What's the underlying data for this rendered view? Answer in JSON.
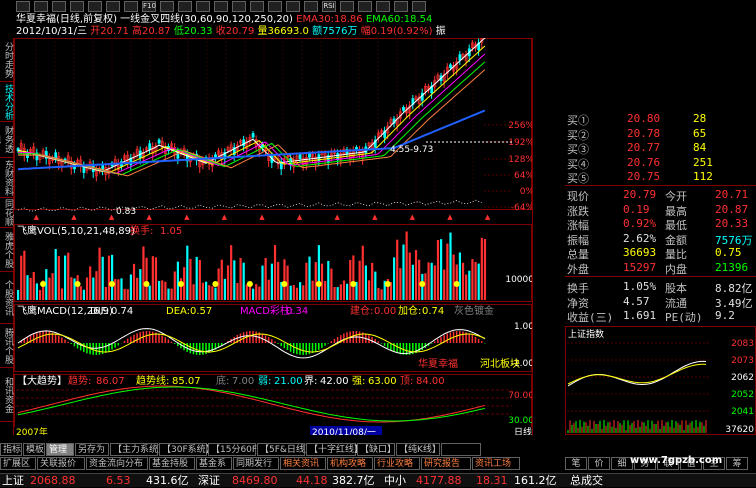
{
  "title_line": {
    "stock": "华夏幸福(日线,前复权)",
    "indicator": "一线金叉四线(30,60,90,120,250,20)",
    "ema30_label": "EMA30:",
    "ema30_value": "18.86",
    "ema60_label": "EMA60:",
    "ema60_value": "18.54"
  },
  "info_line": {
    "date": "2012/10/31/三",
    "open_label": "开",
    "open": "20.71",
    "high_label": "高",
    "high": "20.87",
    "low_label": "低",
    "low": "20.33",
    "close_label": "收",
    "close": "20.79",
    "vol_label": "量",
    "vol": "36693.0",
    "amount_label": "额",
    "amount": "7576万",
    "chg_label": "幅",
    "chg": "0.19(0.92%)",
    "end": "振"
  },
  "toolbar": [
    "",
    "",
    "",
    "",
    "",
    "",
    "",
    "F10",
    "",
    "",
    "",
    "",
    "",
    "",
    "",
    "",
    "",
    "RSI",
    "",
    "",
    "",
    "",
    ""
  ],
  "left_tabs": [
    {
      "label": "分时走势",
      "active": false
    },
    {
      "label": "技术分析",
      "active": true
    },
    {
      "label": "财务透视",
      "active": false
    },
    {
      "label": "东财资料",
      "active": false
    },
    {
      "label": "同花顺",
      "active": false
    },
    {
      "label": "雅虎个股",
      "active": false
    },
    {
      "label": "个股资讯",
      "active": false
    },
    {
      "label": "腾讯个股",
      "active": false
    },
    {
      "label": "和讯资金",
      "active": false
    }
  ],
  "main_chart": {
    "pct_ticks": [
      "256%",
      "192%",
      "128%",
      "64%",
      "0%",
      "-64%"
    ],
    "annotation_high": "4.55-9.73",
    "annotation_low": "0.83"
  },
  "vol_panel": {
    "title": "飞鹰VOL(5,10,21,48,89)",
    "turnover_label": "换手:",
    "turnover_value": "1.05",
    "tick": "10000"
  },
  "macd_panel": {
    "title": "飞鹰MACD(12,26,9)",
    "dif_label": "DIF:",
    "dif_value": "0.74",
    "dea_label": "DEA:",
    "dea_value": "0.57",
    "macd_label": "MACD彩柱:",
    "macd_value": "0.34",
    "jian_label": "建仓:",
    "jian_value": "0.00",
    "jia_label": "加仓:",
    "jia_value": "0.74",
    "grey": "灰色镀金",
    "tick_top": "1.00",
    "tick_bottom": "-1.00",
    "note1": "华夏幸福",
    "note2": "河北板块"
  },
  "trend_panel": {
    "title": "【大趋势】",
    "qs_label": "趋势:",
    "qs_value": "86.07",
    "qsx_label": "趋势线:",
    "qsx_value": "85.07",
    "di_label": "底:",
    "di_value": "7.00",
    "ruo_label": "弱:",
    "ruo_value": "21.00",
    "jie_label": "界:",
    "jie_value": "42.00",
    "qiang_label": "强:",
    "qiang_value": "63.00",
    "ding_label": "顶:",
    "ding_value": "84.00",
    "tick_top": "70.00",
    "tick_bottom": "30.00"
  },
  "axis": {
    "date_left": "2007年",
    "date_marker": "2010/11/08/一",
    "period": "日线"
  },
  "quotes": {
    "asks": [
      {
        "label": "买①",
        "price": "20.80",
        "vol": "28"
      },
      {
        "label": "买②",
        "price": "20.78",
        "vol": "65"
      },
      {
        "label": "买③",
        "price": "20.77",
        "vol": "84"
      },
      {
        "label": "买④",
        "price": "20.76",
        "vol": "251"
      },
      {
        "label": "买⑤",
        "price": "20.75",
        "vol": "112"
      }
    ],
    "stats": [
      {
        "l1": "现价",
        "v1": "20.79",
        "l2": "今开",
        "v2": "20.71",
        "c1": "#ff3030",
        "c2": "#ff3030"
      },
      {
        "l1": "涨跌",
        "v1": "0.19",
        "l2": "最高",
        "v2": "20.87",
        "c1": "#ff3030",
        "c2": "#ff3030"
      },
      {
        "l1": "涨幅",
        "v1": "0.92%",
        "l2": "最低",
        "v2": "20.33",
        "c1": "#ff3030",
        "c2": "#ff3030"
      },
      {
        "l1": "振幅",
        "v1": "2.62%",
        "l2": "金额",
        "v2": "7576万",
        "c1": "#e0e0e0",
        "c2": "#00ffff"
      },
      {
        "l1": "总量",
        "v1": "36693",
        "l2": "量比",
        "v2": "0.75",
        "c1": "#ffff00",
        "c2": "#ffff00"
      },
      {
        "l1": "外盘",
        "v1": "15297",
        "l2": "内盘",
        "v2": "21396",
        "c1": "#ff3030",
        "c2": "#00ff00"
      }
    ],
    "stats2": [
      {
        "l1": "换手",
        "v1": "1.05%",
        "l2": "股本",
        "v2": "8.82亿"
      },
      {
        "l1": "净资",
        "v1": "4.57",
        "l2": "流通",
        "v2": "3.49亿"
      },
      {
        "l1": "收益(三)",
        "v1": "1.691",
        "l2": "PE(动)",
        "v2": "9.2"
      }
    ]
  },
  "mini_chart": {
    "title": "上证指数",
    "ticks": [
      "2083",
      "2073",
      "2062",
      "2052",
      "2041"
    ],
    "vol_tick": "37620"
  },
  "bottom_tabs_row1": [
    {
      "label": "指标",
      "on": false
    },
    {
      "label": "模板",
      "on": false
    },
    {
      "label": "管理",
      "on": true
    },
    {
      "label": "另存为",
      "on": false
    },
    {
      "label": "【主力系统】",
      "on": false
    },
    {
      "label": "【30F系统】",
      "on": false
    },
    {
      "label": "【15分60F】",
      "on": false
    },
    {
      "label": "【5F&日线】",
      "on": false
    },
    {
      "label": "【十字红线】",
      "on": false
    },
    {
      "label": "【缺口】",
      "on": false
    },
    {
      "label": "【纯K线】",
      "on": false
    },
    {
      "label": "",
      "on": false
    }
  ],
  "bottom_tabs_row2": [
    {
      "label": "扩展区",
      "on": false
    },
    {
      "label": "关联报价",
      "on": false
    },
    {
      "label": "资金流向分布",
      "on": false
    },
    {
      "label": "基金持股",
      "on": false
    },
    {
      "label": "基金系",
      "on": false
    },
    {
      "label": "同期发行",
      "on": false
    },
    {
      "label": "相关资讯",
      "on": false
    },
    {
      "label": "机构攻略",
      "on": false
    },
    {
      "label": "行业攻略",
      "on": false
    },
    {
      "label": "研究报告",
      "on": false
    },
    {
      "label": "资讯工场",
      "on": false
    }
  ],
  "right_buttons": [
    "笔",
    "价",
    "细",
    "势",
    "联",
    "值",
    "主",
    "筹"
  ],
  "statusbar": {
    "sh_label": "上证",
    "sh_value": "2068.88",
    "sh_chg": "6.53",
    "sh_amt": "431.6亿",
    "sz_label": "深证",
    "sz_value": "8469.80",
    "sz_chg": "44.18",
    "sz_amt": "382.7亿",
    "zx_label": "中小",
    "zx_value": "4177.88",
    "zx_chg": "18.31",
    "zx_amt": "161.2亿",
    "end": "总成交"
  },
  "watermark": "www.7gpzb.com",
  "colors": {
    "up": "#ff3030",
    "down": "#00ff00",
    "bg": "#000000",
    "grid": "#800000",
    "accent_cyan": "#00ffff",
    "yellow": "#ffff00"
  }
}
